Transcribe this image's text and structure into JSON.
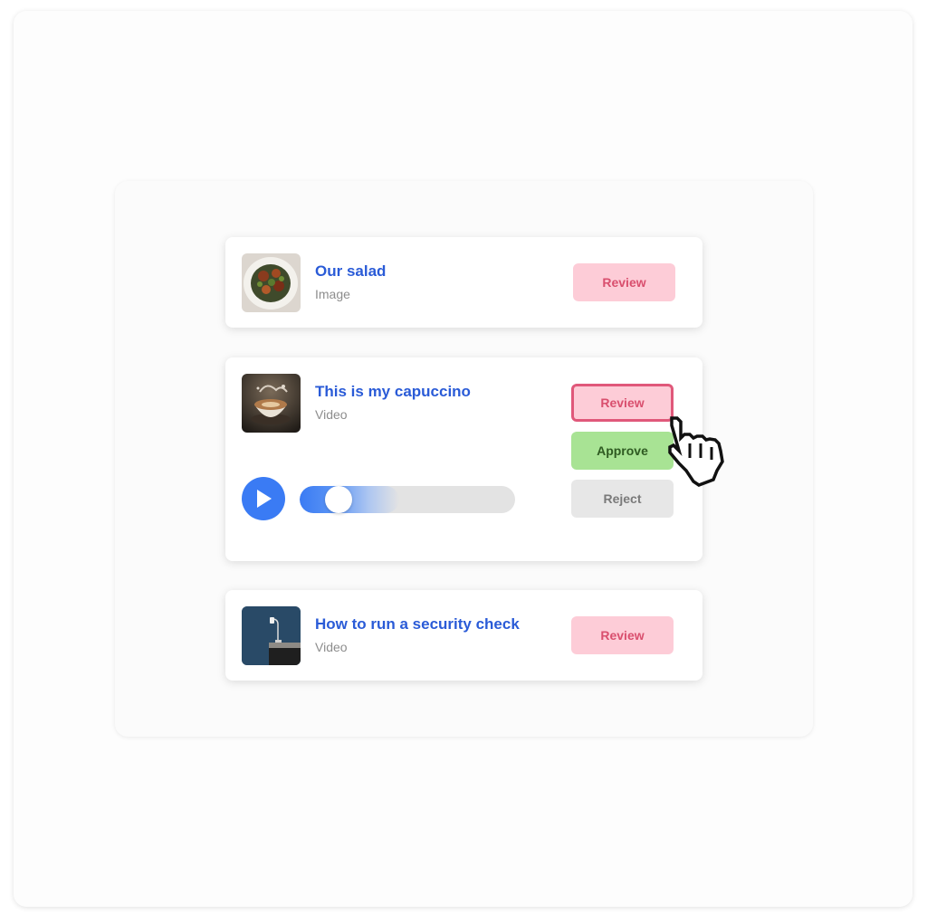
{
  "items": [
    {
      "title": "Our salad",
      "type": "Image",
      "thumbnail_icon": "salad-photo",
      "review_label": "Review"
    },
    {
      "title": "This is my capuccino",
      "type": "Video",
      "thumbnail_icon": "cappuccino-photo",
      "review_label": "Review",
      "approve_label": "Approve",
      "reject_label": "Reject",
      "playback_progress_fraction": 0.18
    },
    {
      "title": "How to run a security check",
      "type": "Video",
      "thumbnail_icon": "desk-lamp-photo",
      "review_label": "Review"
    }
  ],
  "colors": {
    "title": "#2a5bd7",
    "review_bg": "#fdccd7",
    "review_text": "#d94f6e",
    "approve_bg": "#a8e394",
    "reject_bg": "#e7e7e7",
    "play": "#3a7bf4"
  },
  "cursor_icon": "pointing-hand-cursor"
}
